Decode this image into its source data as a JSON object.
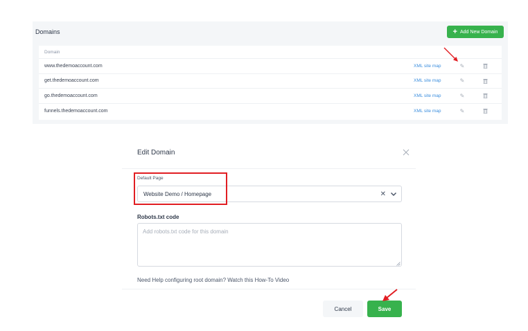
{
  "domains_panel": {
    "title": "Domains",
    "add_button_label": "Add New Domain",
    "column_header": "Domain",
    "rows": [
      {
        "domain": "www.thedemoaccount.com",
        "xml_link": "XML site map"
      },
      {
        "domain": "get.thedemoaccount.com",
        "xml_link": "XML site map"
      },
      {
        "domain": "go.thedemoaccount.com",
        "xml_link": "XML site map"
      },
      {
        "domain": "funnels.thedemoaccount.com",
        "xml_link": "XML site map"
      }
    ]
  },
  "modal": {
    "title": "Edit Domain",
    "default_page_label": "Default Page",
    "default_page_value": "Website Demo / Homepage",
    "robots_label": "Robots.txt code",
    "robots_placeholder": "Add robots.txt code for this domain",
    "help_text": "Need Help configuring root domain? Watch this How-To Video",
    "cancel_label": "Cancel",
    "save_label": "Save"
  },
  "colors": {
    "accent_green": "#37b24d",
    "link_blue": "#3b8ede",
    "annotation_red": "#e11d22"
  }
}
